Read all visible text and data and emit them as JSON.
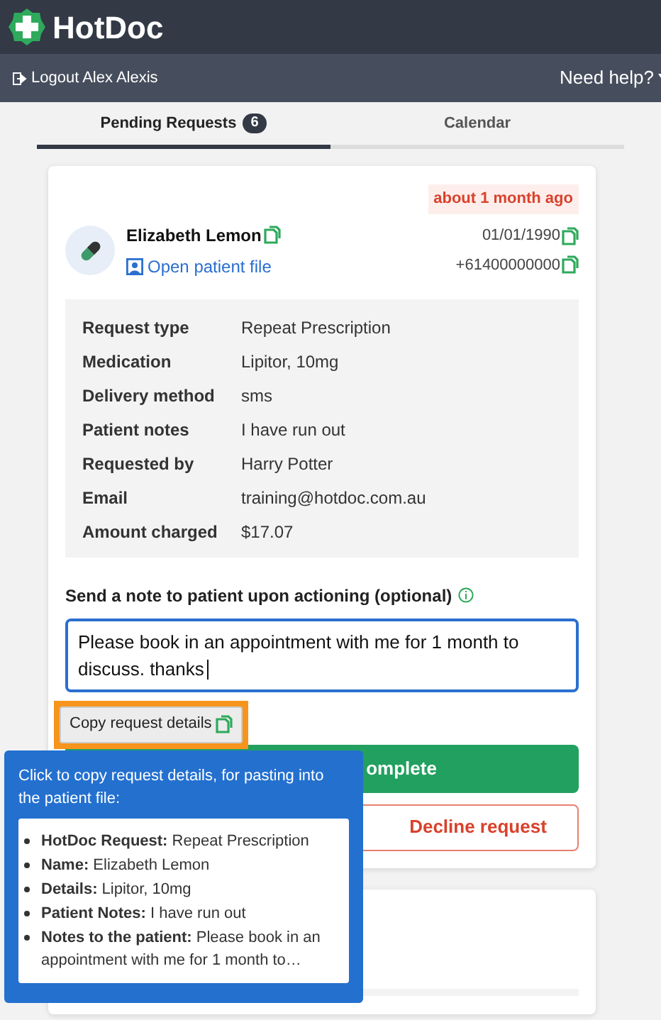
{
  "header": {
    "logo": "HotDoc"
  },
  "user_bar": {
    "logout": "Logout Alex Alexis",
    "help": "Need help?"
  },
  "tabs": [
    {
      "label": "Pending Requests",
      "badge": "6",
      "selected": true
    },
    {
      "label": "Calendar",
      "selected": false
    }
  ],
  "request": {
    "time_ago": "about 1 month ago",
    "patient_name": "Elizabeth Lemon",
    "open_file": "Open patient file",
    "dob": "01/01/1990",
    "phone": "+61400000000",
    "details": [
      {
        "label": "Request type",
        "value": "Repeat Prescription"
      },
      {
        "label": "Medication",
        "value": "Lipitor, 10mg"
      },
      {
        "label": "Delivery method",
        "value": "sms"
      },
      {
        "label": "Patient notes",
        "value": "I have run out"
      },
      {
        "label": "Requested by",
        "value": "Harry Potter"
      },
      {
        "label": "Email",
        "value": "training@hotdoc.com.au"
      },
      {
        "label": "Amount charged",
        "value": "$17.07"
      }
    ],
    "note_label": "Send a note to patient upon actioning (optional)",
    "note_value": "Please book in an appointment with me for 1 month to discuss. thanks",
    "copy_button": {
      "label": "Copy request details",
      "highlighted": true
    },
    "complete_button": "omplete",
    "decline_button": "Decline request"
  },
  "tooltip": {
    "intro": "Click to copy request details, for pasting into the patient file:",
    "items": [
      "**HotDoc Request:** Repeat Prescription",
      "**Name:** Elizabeth Lemon",
      "**Details:** Lipitor, 10mg",
      "**Patient Notes:** I have run out",
      "**Notes to the patient:** Please book in an appointment with me for 1 month to…"
    ]
  }
}
